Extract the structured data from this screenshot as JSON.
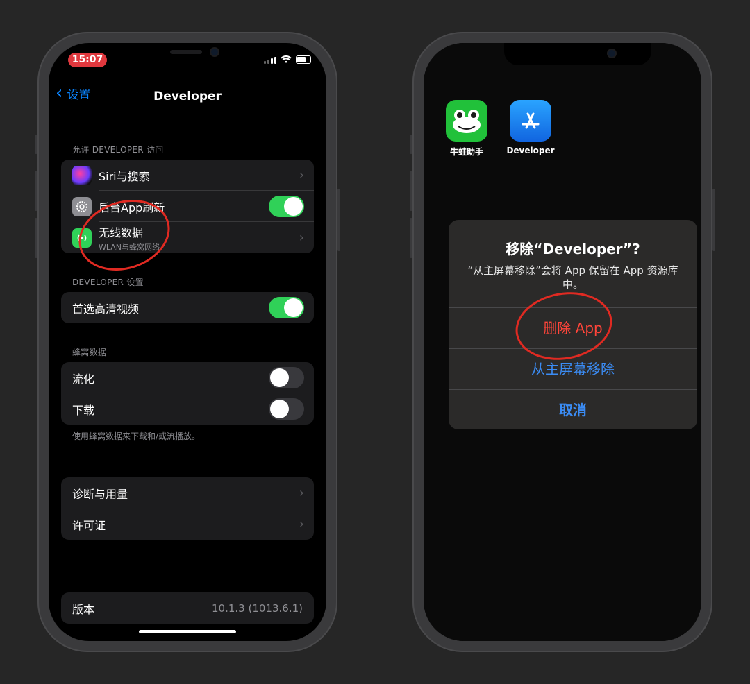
{
  "left": {
    "status": {
      "time": "15:07"
    },
    "nav": {
      "back_label": "设置",
      "title": "Developer"
    },
    "section1": {
      "header": "允许 DEVELOPER 访问",
      "rows": [
        {
          "label": "Siri与搜索"
        },
        {
          "label": "后台App刷新",
          "toggle": true
        },
        {
          "label": "无线数据",
          "sublabel": "WLAN与蜂窝网络"
        }
      ]
    },
    "section2": {
      "header": "DEVELOPER 设置",
      "rows": [
        {
          "label": "首选高清视频",
          "toggle": true
        }
      ]
    },
    "section3": {
      "header": "蜂窝数据",
      "rows": [
        {
          "label": "流化",
          "toggle": false
        },
        {
          "label": "下载",
          "toggle": false
        }
      ],
      "footer": "使用蜂窝数据来下载和/或流播放。"
    },
    "section4": {
      "rows": [
        {
          "label": "诊断与用量"
        },
        {
          "label": "许可证"
        }
      ]
    },
    "section5": {
      "rows": [
        {
          "label": "版本",
          "value": "10.1.3 (1013.6.1)"
        }
      ]
    }
  },
  "right": {
    "apps": [
      {
        "name": "牛蛙助手"
      },
      {
        "name": "Developer"
      }
    ],
    "alert": {
      "title": "移除“Developer”?",
      "message": "“从主屏幕移除”会将 App 保留在 App 资源库中。",
      "delete_label": "删除 App",
      "remove_label": "从主屏幕移除",
      "cancel_label": "取消"
    }
  },
  "colors": {
    "accent": "#0a84ff",
    "toggle_on": "#30d158",
    "destructive": "#ff453a",
    "annotation": "#e02a22"
  }
}
